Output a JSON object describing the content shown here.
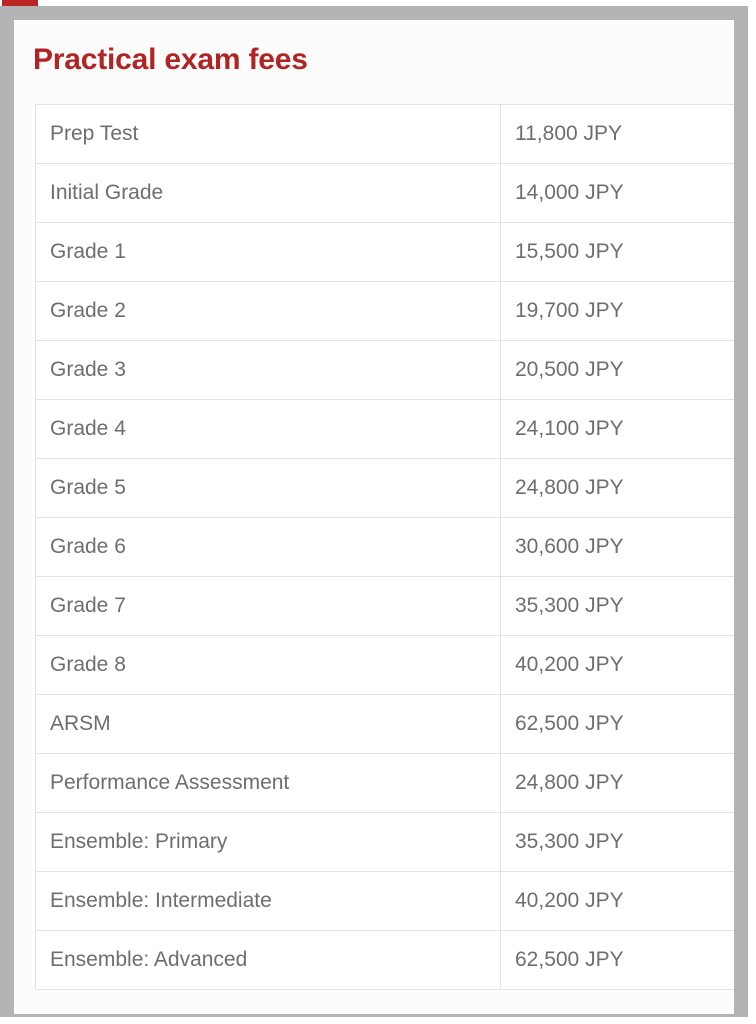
{
  "card": {
    "title": "Practical exam fees",
    "title_color": "#b02523",
    "background_color": "#fcfcfc",
    "frame_color": "#b4b4b4",
    "accent_sliver_color": "#bb2624",
    "text_color": "#6e6e6e",
    "border_color": "#e3e3e3"
  },
  "table": {
    "columns": [
      "exam",
      "fee"
    ],
    "rows": [
      {
        "exam": "Prep Test",
        "fee": "11,800 JPY"
      },
      {
        "exam": "Initial Grade",
        "fee": "14,000 JPY"
      },
      {
        "exam": "Grade 1",
        "fee": "15,500 JPY"
      },
      {
        "exam": "Grade 2",
        "fee": "19,700 JPY"
      },
      {
        "exam": "Grade 3",
        "fee": "20,500 JPY"
      },
      {
        "exam": "Grade 4",
        "fee": "24,100 JPY"
      },
      {
        "exam": "Grade 5",
        "fee": "24,800 JPY"
      },
      {
        "exam": "Grade 6",
        "fee": "30,600 JPY"
      },
      {
        "exam": "Grade 7",
        "fee": "35,300 JPY"
      },
      {
        "exam": "Grade 8",
        "fee": "40,200 JPY"
      },
      {
        "exam": "ARSM",
        "fee": "62,500 JPY"
      },
      {
        "exam": "Performance Assessment",
        "fee": "24,800 JPY"
      },
      {
        "exam": "Ensemble: Primary",
        "fee": "35,300 JPY"
      },
      {
        "exam": "Ensemble: Intermediate",
        "fee": "40,200 JPY"
      },
      {
        "exam": "Ensemble: Advanced",
        "fee": "62,500 JPY"
      }
    ]
  }
}
